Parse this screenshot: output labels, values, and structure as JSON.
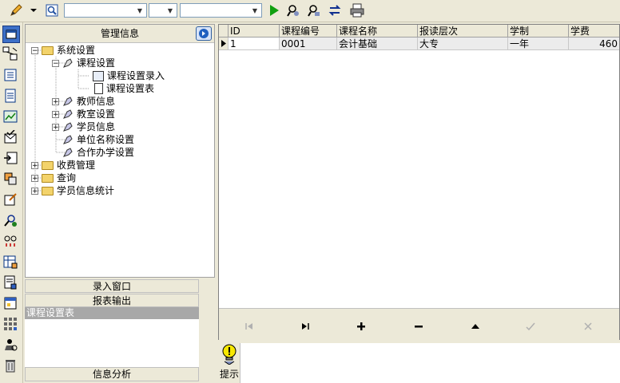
{
  "toolbar": {
    "icons": [
      "pencil-icon",
      "search-icon",
      "run-icon",
      "find-user-icon",
      "find-user-2-icon",
      "refresh-icon",
      "printer-icon"
    ],
    "combo1_value": "",
    "combo2_value": "",
    "combo3_value": ""
  },
  "left_panel": {
    "header": "管理信息",
    "tree": [
      {
        "label": "系统设置",
        "level": 0,
        "expanded": true
      },
      {
        "label": "课程设置",
        "level": 1,
        "expanded": true
      },
      {
        "label": "课程设置录入",
        "level": 2
      },
      {
        "label": "课程设置表",
        "level": 2
      },
      {
        "label": "教师信息",
        "level": 1
      },
      {
        "label": "教室设置",
        "level": 1
      },
      {
        "label": "学员信息",
        "level": 1
      },
      {
        "label": "单位名称设置",
        "level": 1
      },
      {
        "label": "合作办学设置",
        "level": 1
      },
      {
        "label": "收费管理",
        "level": 0
      },
      {
        "label": "查询",
        "level": 0
      },
      {
        "label": "学员信息统计",
        "level": 0
      }
    ],
    "sections": {
      "input_window": "录入窗口",
      "report_output": "报表输出",
      "selected_report": "课程设置表",
      "info_analysis": "信息分析"
    }
  },
  "grid": {
    "columns": [
      "ID",
      "课程编号",
      "课程名称",
      "报读层次",
      "学制",
      "学费"
    ],
    "rows": [
      [
        "1",
        "0001",
        "会计基础",
        "大专",
        "一年",
        "460"
      ]
    ]
  },
  "hint": {
    "label": "提示"
  }
}
